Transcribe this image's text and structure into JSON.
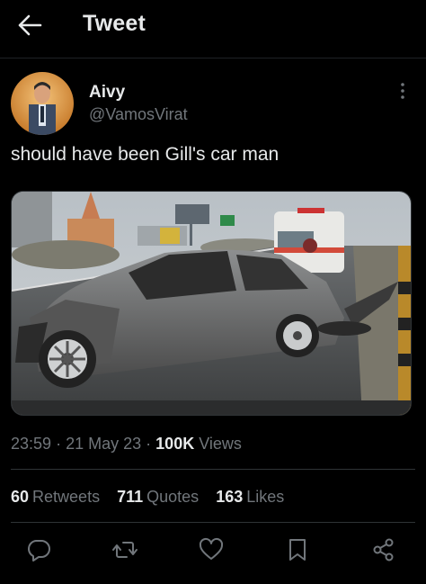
{
  "header": {
    "title": "Tweet",
    "back_icon": "arrow-left-icon"
  },
  "author": {
    "name": "Aivy",
    "handle": "@VamosVirat"
  },
  "tweet": {
    "text": "should have been Gill's car man"
  },
  "meta": {
    "time": "23:59",
    "date": "21 May 23",
    "views_count": "100K",
    "views_label": "Views"
  },
  "stats": {
    "retweets_count": "60",
    "retweets_label": "Retweets",
    "quotes_count": "711",
    "quotes_label": "Quotes",
    "likes_count": "163",
    "likes_label": "Likes"
  },
  "actions": [
    "reply-icon",
    "retweet-icon",
    "like-icon",
    "bookmark-icon",
    "share-icon"
  ],
  "colors": {
    "background": "#000000",
    "text": "#e7e9ea",
    "secondary": "#71767b",
    "divider": "#2f3336"
  }
}
